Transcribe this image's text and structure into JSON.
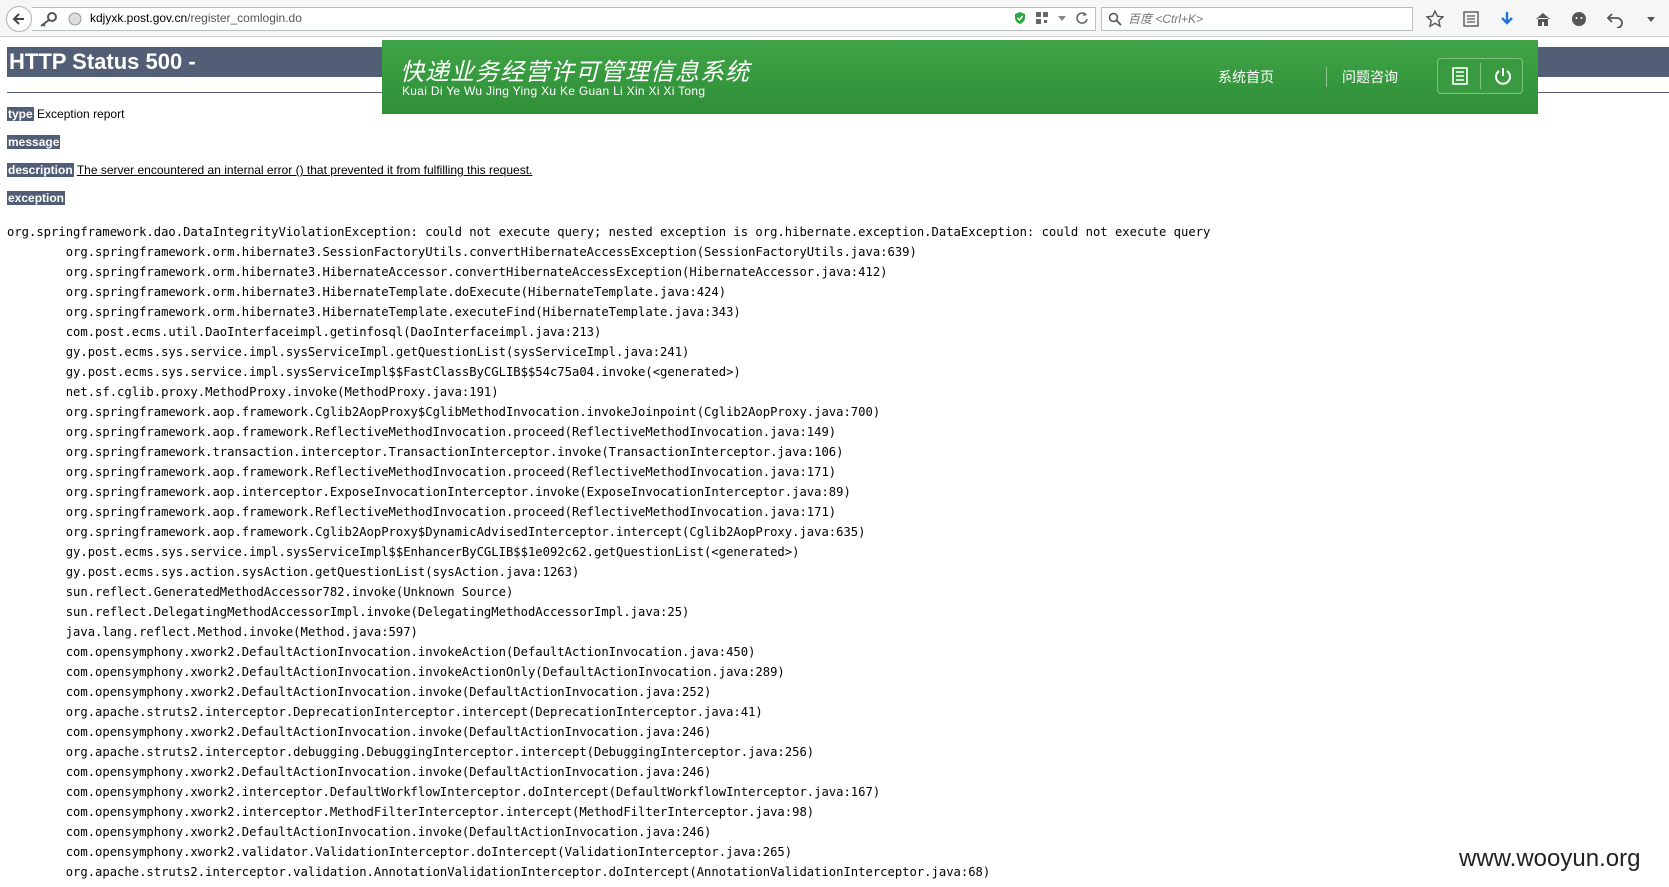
{
  "browser": {
    "url_host": "kdjyxk.post.gov.cn",
    "url_path": "/register_comlogin.do",
    "search_placeholder": "百度 <Ctrl+K>"
  },
  "error_page": {
    "title": "HTTP Status 500 -",
    "type_label": "type",
    "type_value": "Exception report",
    "message_label": "message",
    "description_label": "description",
    "description_value": "The server encountered an internal error () that prevented it from fulfilling this request.",
    "exception_label": "exception",
    "stack_trace": [
      "org.springframework.dao.DataIntegrityViolationException: could not execute query; nested exception is org.hibernate.exception.DataException: could not execute query",
      "\torg.springframework.orm.hibernate3.SessionFactoryUtils.convertHibernateAccessException(SessionFactoryUtils.java:639)",
      "\torg.springframework.orm.hibernate3.HibernateAccessor.convertHibernateAccessException(HibernateAccessor.java:412)",
      "\torg.springframework.orm.hibernate3.HibernateTemplate.doExecute(HibernateTemplate.java:424)",
      "\torg.springframework.orm.hibernate3.HibernateTemplate.executeFind(HibernateTemplate.java:343)",
      "\tcom.post.ecms.util.DaoInterfaceimpl.getinfosql(DaoInterfaceimpl.java:213)",
      "\tgy.post.ecms.sys.service.impl.sysServiceImpl.getQuestionList(sysServiceImpl.java:241)",
      "\tgy.post.ecms.sys.service.impl.sysServiceImpl$$FastClassByCGLIB$$54c75a04.invoke(<generated>)",
      "\tnet.sf.cglib.proxy.MethodProxy.invoke(MethodProxy.java:191)",
      "\torg.springframework.aop.framework.Cglib2AopProxy$CglibMethodInvocation.invokeJoinpoint(Cglib2AopProxy.java:700)",
      "\torg.springframework.aop.framework.ReflectiveMethodInvocation.proceed(ReflectiveMethodInvocation.java:149)",
      "\torg.springframework.transaction.interceptor.TransactionInterceptor.invoke(TransactionInterceptor.java:106)",
      "\torg.springframework.aop.framework.ReflectiveMethodInvocation.proceed(ReflectiveMethodInvocation.java:171)",
      "\torg.springframework.aop.interceptor.ExposeInvocationInterceptor.invoke(ExposeInvocationInterceptor.java:89)",
      "\torg.springframework.aop.framework.ReflectiveMethodInvocation.proceed(ReflectiveMethodInvocation.java:171)",
      "\torg.springframework.aop.framework.Cglib2AopProxy$DynamicAdvisedInterceptor.intercept(Cglib2AopProxy.java:635)",
      "\tgy.post.ecms.sys.service.impl.sysServiceImpl$$EnhancerByCGLIB$$1e092c62.getQuestionList(<generated>)",
      "\tgy.post.ecms.sys.action.sysAction.getQuestionList(sysAction.java:1263)",
      "\tsun.reflect.GeneratedMethodAccessor782.invoke(Unknown Source)",
      "\tsun.reflect.DelegatingMethodAccessorImpl.invoke(DelegatingMethodAccessorImpl.java:25)",
      "\tjava.lang.reflect.Method.invoke(Method.java:597)",
      "\tcom.opensymphony.xwork2.DefaultActionInvocation.invokeAction(DefaultActionInvocation.java:450)",
      "\tcom.opensymphony.xwork2.DefaultActionInvocation.invokeActionOnly(DefaultActionInvocation.java:289)",
      "\tcom.opensymphony.xwork2.DefaultActionInvocation.invoke(DefaultActionInvocation.java:252)",
      "\torg.apache.struts2.interceptor.DeprecationInterceptor.intercept(DeprecationInterceptor.java:41)",
      "\tcom.opensymphony.xwork2.DefaultActionInvocation.invoke(DefaultActionInvocation.java:246)",
      "\torg.apache.struts2.interceptor.debugging.DebuggingInterceptor.intercept(DebuggingInterceptor.java:256)",
      "\tcom.opensymphony.xwork2.DefaultActionInvocation.invoke(DefaultActionInvocation.java:246)",
      "\tcom.opensymphony.xwork2.interceptor.DefaultWorkflowInterceptor.doIntercept(DefaultWorkflowInterceptor.java:167)",
      "\tcom.opensymphony.xwork2.interceptor.MethodFilterInterceptor.intercept(MethodFilterInterceptor.java:98)",
      "\tcom.opensymphony.xwork2.DefaultActionInvocation.invoke(DefaultActionInvocation.java:246)",
      "\tcom.opensymphony.xwork2.validator.ValidationInterceptor.doIntercept(ValidationInterceptor.java:265)",
      "\torg.apache.struts2.interceptor.validation.AnnotationValidationInterceptor.doIntercept(AnnotationValidationInterceptor.java:68)"
    ]
  },
  "banner": {
    "title": "快递业务经营许可管理信息系统",
    "subtitle": "Kuai Di Ye Wu Jing Ying Xu Ke Guan Li Xin Xi Xi Tong",
    "nav_home": "系统首页",
    "nav_question": "问题咨询"
  },
  "watermark": "www.wooyun.org",
  "colors": {
    "tomcat_header": "#525d76",
    "banner_green": "#35983c"
  }
}
